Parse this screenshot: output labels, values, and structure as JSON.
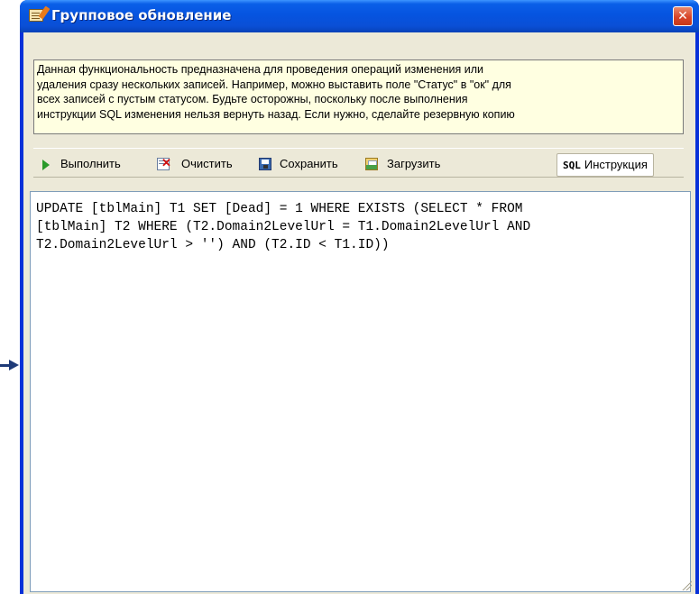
{
  "window": {
    "title": "Групповое обновление",
    "icon": "pencil-note-icon",
    "close_glyph": "✕"
  },
  "info": {
    "line1": "Данная функциональность предназначена для проведения операций изменения или",
    "line2": "удаления сразу нескольких записей. Например, можно выставить поле \"Статус\" в \"ок\" для",
    "line3": "всех записей с пустым статусом. Будьте осторожны, поскольку после выполнения",
    "line4": "инструкции SQL изменения нельзя вернуть назад. Если нужно, сделайте резервную копию"
  },
  "toolbar": {
    "run_label": "Выполнить",
    "clear_label": "Очистить",
    "save_label": "Сохранить",
    "load_label": "Загрузить",
    "sql_mark": "SQL",
    "sql_label": "Инструкция"
  },
  "editor": {
    "sql_text": "UPDATE [tblMain] T1 SET [Dead] = 1 WHERE EXISTS (SELECT * FROM\n[tblMain] T2 WHERE (T2.Domain2LevelUrl = T1.Domain2LevelUrl AND\nT2.Domain2LevelUrl > '') AND (T2.ID < T1.ID))"
  },
  "colors": {
    "titlebar": "#0a5fe8",
    "client": "#ece9d8",
    "info_bg": "#ffffe1",
    "close": "#d8452a",
    "pointer_arrow": "#1e3a78"
  }
}
